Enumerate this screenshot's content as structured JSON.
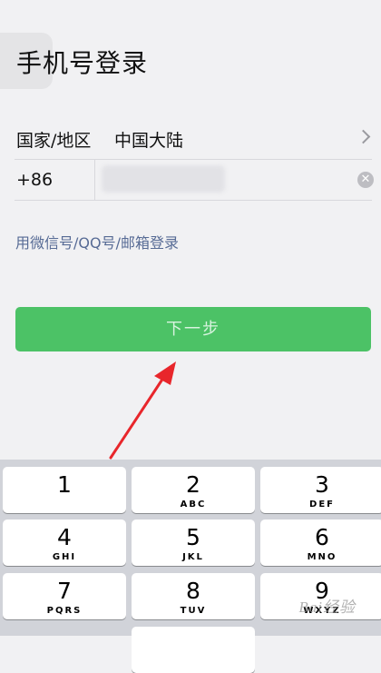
{
  "header": {
    "title": "手机号登录"
  },
  "region": {
    "label": "国家/地区",
    "value": "中国大陆"
  },
  "phone": {
    "country_code": "+86",
    "value": "",
    "clear_icon": "clear-circle-icon"
  },
  "alt_login": {
    "text": "用微信号/QQ号/邮箱登录"
  },
  "next_button": {
    "label": "下一步"
  },
  "keypad": {
    "keys": [
      {
        "number": "1",
        "letters": ""
      },
      {
        "number": "2",
        "letters": "ABC"
      },
      {
        "number": "3",
        "letters": "DEF"
      },
      {
        "number": "4",
        "letters": "GHI"
      },
      {
        "number": "5",
        "letters": "JKL"
      },
      {
        "number": "6",
        "letters": "MNO"
      },
      {
        "number": "7",
        "letters": "PQRS"
      },
      {
        "number": "8",
        "letters": "TUV"
      },
      {
        "number": "9",
        "letters": "WXYZ"
      }
    ]
  },
  "watermark": {
    "text": "Bai经验"
  },
  "colors": {
    "accent_green": "#4cc266",
    "link_blue": "#576b95",
    "annotation_red": "#e8262b"
  }
}
